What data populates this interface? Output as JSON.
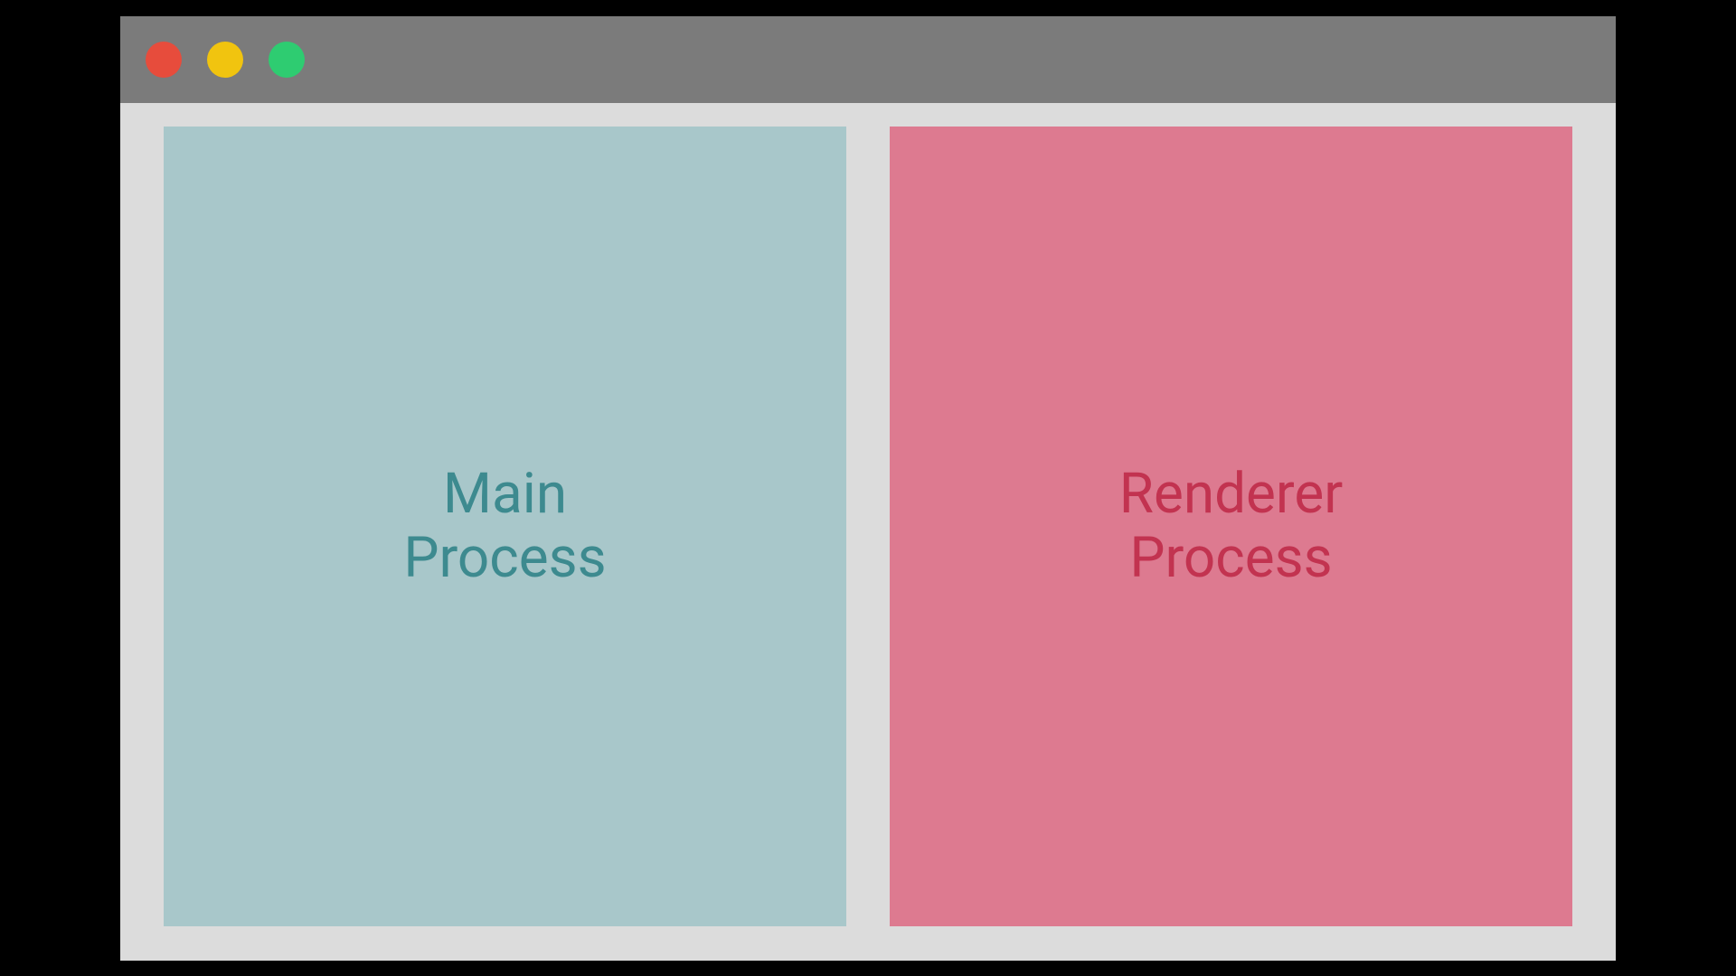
{
  "panels": {
    "left": {
      "label": "Main\nProcess",
      "bg": "#a8c7ca",
      "fg": "#3d8a8f"
    },
    "right": {
      "label": "Renderer\nProcess",
      "bg": "#dd7a90",
      "fg": "#c23350"
    }
  },
  "window_controls": {
    "close": "#e74c3c",
    "minimize": "#f1c40f",
    "maximize": "#2ecc71"
  }
}
